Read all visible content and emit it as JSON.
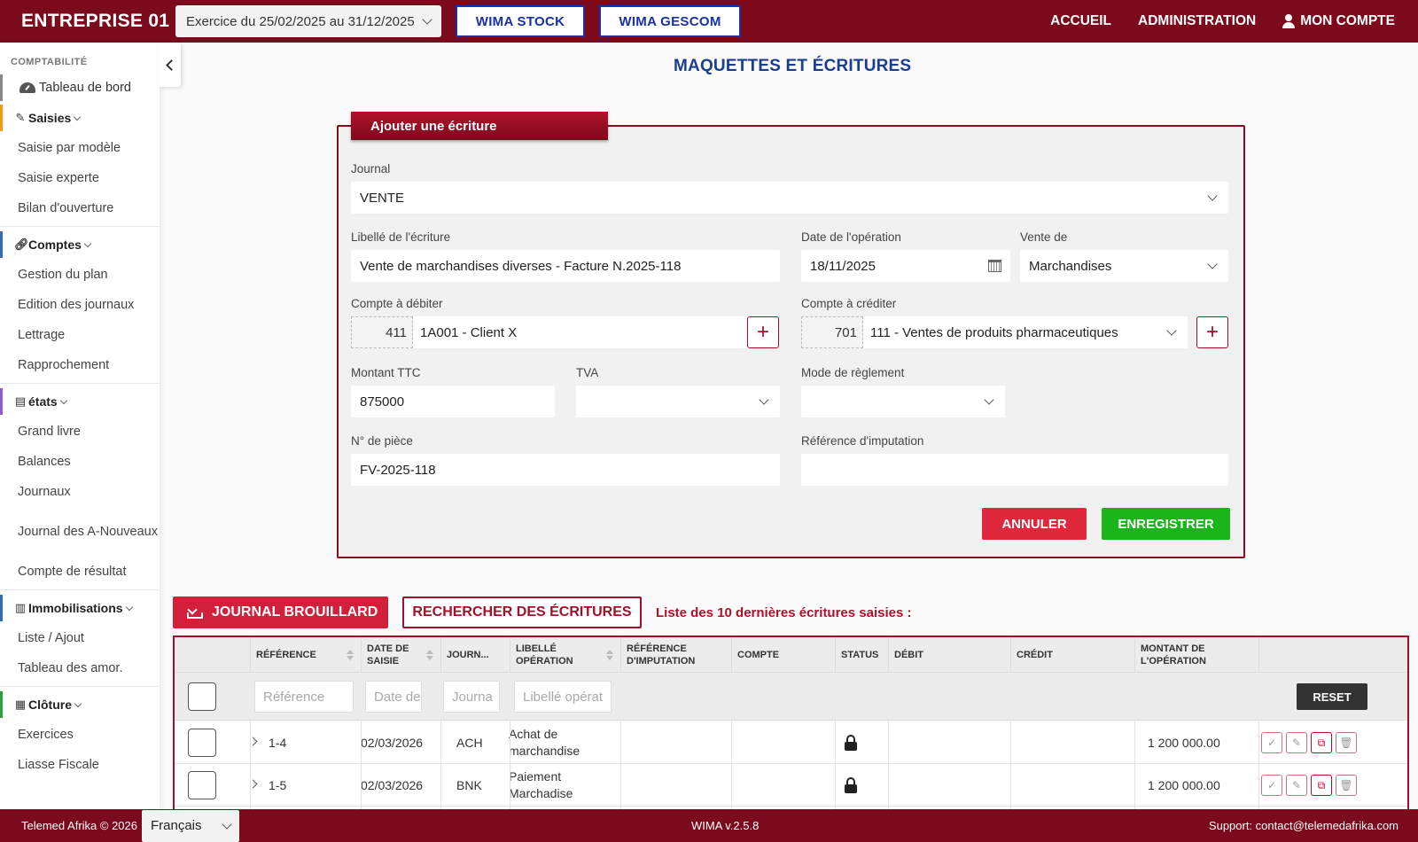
{
  "header": {
    "brand": "ENTREPRISE 01",
    "exercise": "Exercice du 25/02/2025 au 31/12/2025",
    "btn_stock": "WIMA STOCK",
    "btn_gescom": "WIMA GESCOM",
    "nav": {
      "home": "ACCUEIL",
      "admin": "ADMINISTRATION",
      "account": "MON COMPTE"
    }
  },
  "sidebar": {
    "section": "COMPTABILITÉ",
    "dashboard": "Tableau de bord",
    "groups": {
      "saisies": {
        "title": "Saisies",
        "items": [
          "Saisie par modèle",
          "Saisie experte",
          "Bilan d'ouverture"
        ]
      },
      "comptes": {
        "title": "Comptes",
        "items": [
          "Gestion du plan",
          "Edition des journaux",
          "Lettrage",
          "Rapprochement"
        ]
      },
      "etats": {
        "title": "états",
        "items": [
          "Grand livre",
          "Balances",
          "Journaux",
          "Journal des A-Nouveaux",
          "Compte de résultat"
        ]
      },
      "immobilisations": {
        "title": "Immobilisations",
        "items": [
          "Liste / Ajout",
          "Tableau des amor."
        ]
      },
      "cloture": {
        "title": "Clôture",
        "items": [
          "Exercices",
          "Liasse Fiscale"
        ]
      }
    },
    "colors": {
      "saisies": "#f39c12",
      "comptes": "#2c6fb7",
      "etats": "#8e5bd6",
      "immobilisations": "#2c6fb7",
      "cloture": "#27a33a"
    }
  },
  "page": {
    "title": "MAQUETTES ET ÉCRITURES"
  },
  "form": {
    "tab": "Ajouter une écriture",
    "journal_label": "Journal",
    "journal_value": "VENTE",
    "libelle_label": "Libellé de l'écriture",
    "libelle_value": "Vente de marchandises diverses - Facture N.2025-118",
    "date_label": "Date de l'opération",
    "date_value": "18/11/2025",
    "vente_label": "Vente de",
    "vente_value": "Marchandises",
    "debit_label": "Compte à débiter",
    "debit_prefix": "411",
    "debit_value": "1A001 - Client X",
    "credit_label": "Compte à créditer",
    "credit_prefix": "701",
    "credit_value": "111 - Ventes de produits pharmaceutiques",
    "ttc_label": "Montant TTC",
    "ttc_value": "875000",
    "tva_label": "TVA",
    "tva_value": "",
    "mode_label": "Mode de règlement",
    "mode_value": "",
    "piece_label": "N° de pièce",
    "piece_value": "FV-2025-118",
    "ref_label": "Référence d'imputation",
    "ref_value": "",
    "cancel": "ANNULER",
    "save": "ENREGISTRER"
  },
  "actions": {
    "journal": "JOURNAL BROUILLARD",
    "search": "RECHERCHER DES ÉCRITURES",
    "caption": "Liste des 10 dernières écritures saisies :"
  },
  "table": {
    "headers": {
      "reference": "RÉFÉRENCE",
      "date": "DATE DE SAISIE",
      "journal": "JOURN...",
      "libelle": "LIBELLÉ OPÉRATION",
      "ref_imp": "RÉFÉRENCE D'IMPUTATION",
      "compte": "COMPTE",
      "status": "STATUS",
      "debit": "DÉBIT",
      "credit": "CRÉDIT",
      "montant": "MONTANT DE L'OPÉRATION"
    },
    "filters": {
      "reference": "Référence",
      "date": "Date de",
      "journal": "Journa",
      "libelle": "Libellé opérat"
    },
    "reset": "RESET",
    "rows": [
      {
        "ref": "1-4",
        "date": "02/03/2026",
        "journal": "ACH",
        "libelle": "Achat de marchandise",
        "montant": "1 200 000.00",
        "status": "lock-icon"
      },
      {
        "ref": "1-5",
        "date": "02/03/2026",
        "journal": "BNK",
        "libelle": "Paiement Marchadise",
        "montant": "1 200 000.00",
        "status": "lock-icon"
      }
    ]
  },
  "footer": {
    "copyright": "Telemed Afrika © 2026",
    "language": "Français",
    "version": "WIMA v.2.5.8",
    "support": "Support: contact@telemedafrika.com"
  }
}
